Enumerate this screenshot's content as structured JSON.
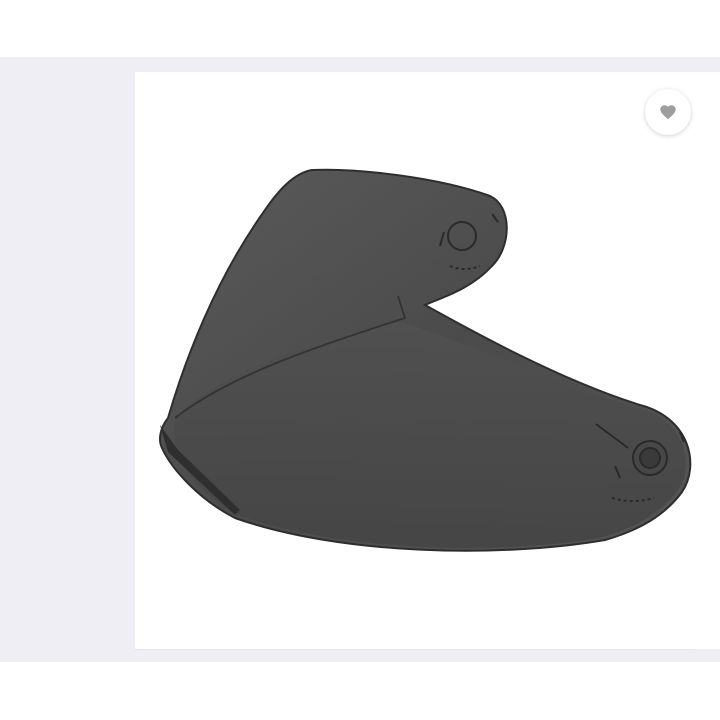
{
  "product": {
    "image_alt": "",
    "wishlist_icon": "heart-icon"
  },
  "colors": {
    "background": "#ffffff",
    "band": "#eeeef4",
    "card": "#ffffff",
    "visor": "#4d4d4d",
    "icon": "#9e9e9e"
  }
}
